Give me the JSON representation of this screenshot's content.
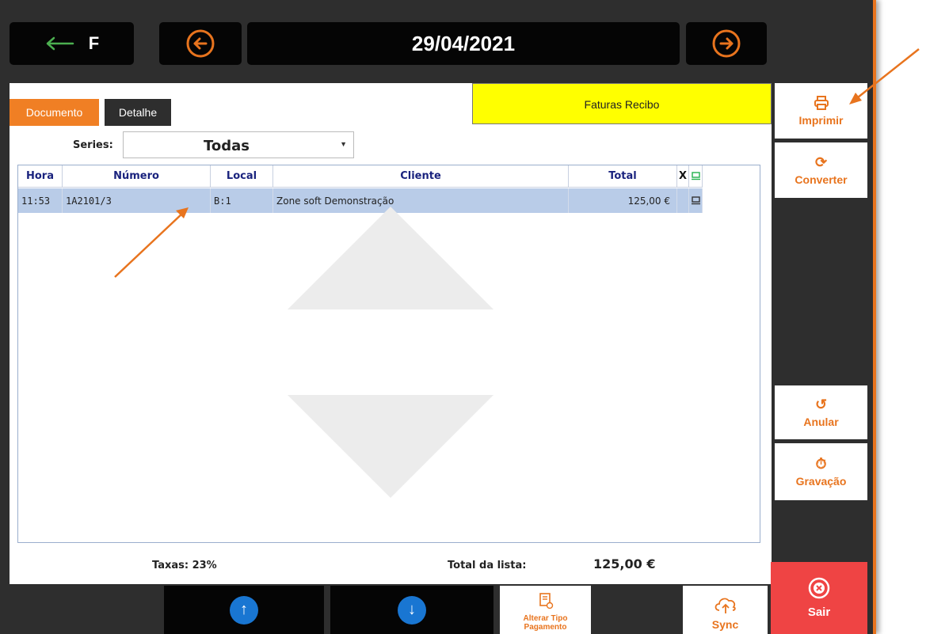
{
  "header": {
    "back_label": "F",
    "date": "29/04/2021"
  },
  "tabs": [
    {
      "label": "Documento",
      "active": true
    },
    {
      "label": "Detalhe",
      "active": false
    }
  ],
  "document_type": "Faturas Recibo",
  "series": {
    "label": "Series:",
    "selected": "Todas"
  },
  "table": {
    "columns": [
      "Hora",
      "Número",
      "Local",
      "Cliente",
      "Total",
      "X"
    ],
    "rows": [
      {
        "hora": "11:53",
        "numero": "1A2101/3",
        "local": "B:1",
        "cliente": "Zone soft Demonstração",
        "total": "125,00 €"
      }
    ]
  },
  "footer": {
    "taxas": "Taxas: 23%",
    "total_label": "Total da lista:",
    "total_value": "125,00 €"
  },
  "side_buttons": {
    "imprimir": "Imprimir",
    "converter": "Converter",
    "anular": "Anular",
    "gravacao": "Gravação",
    "sair": "Sair"
  },
  "bottom_buttons": {
    "alterar_line1": "Alterar Tipo",
    "alterar_line2": "Pagamento",
    "sync": "Sync"
  },
  "colors": {
    "accent": "#e8741e",
    "dark": "#2e2e2e",
    "selection": "#b9cce8",
    "highlight": "#ffff00",
    "danger": "#ef4444",
    "nav_blue": "#1976d2"
  }
}
